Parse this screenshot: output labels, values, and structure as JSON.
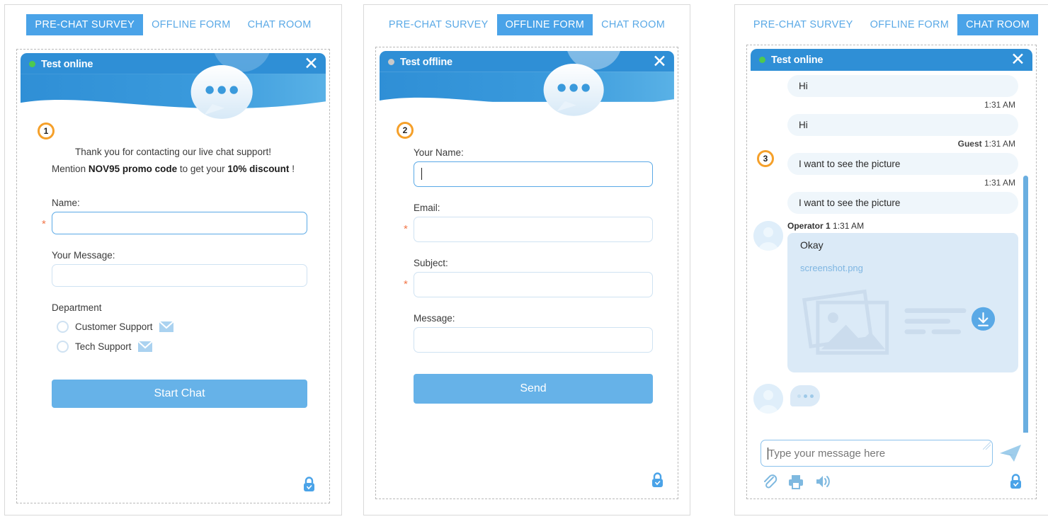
{
  "accent": "#4aa3e8",
  "header_blue": "#2f8fd6",
  "badge_orange": "#f5a02a",
  "online_green": "#4ec94e",
  "offline_grey": "#c9c9c9",
  "tabs": [
    {
      "label": "PRE-CHAT SURVEY"
    },
    {
      "label": "OFFLINE FORM"
    },
    {
      "label": "CHAT ROOM"
    }
  ],
  "panel1": {
    "step": "1",
    "active_tab": "PRE-CHAT SURVEY",
    "widget_title": "Test online",
    "status": "online",
    "close_label": "✕",
    "greeting_line1": "Thank you for contacting our live chat support!",
    "greeting_line2_pre": "Mention ",
    "greeting_line2_b1": "NOV95 promo code",
    "greeting_line2_mid": " to get your ",
    "greeting_line2_b2": "10% discount",
    "greeting_line2_post": " !",
    "name_label": "Name:",
    "name_value": "",
    "name_required": "*",
    "message_label": "Your Message:",
    "message_value": "",
    "department_label": "Department",
    "departments": [
      {
        "label": "Customer Support"
      },
      {
        "label": "Tech Support"
      }
    ],
    "submit_label": "Start Chat"
  },
  "panel2": {
    "step": "2",
    "active_tab": "OFFLINE FORM",
    "widget_title": "Test offline",
    "status": "offline",
    "close_label": "✕",
    "fields": [
      {
        "label": "Your Name:",
        "value": "",
        "required": "",
        "focused": true
      },
      {
        "label": "Email:",
        "value": "",
        "required": "*",
        "focused": false
      },
      {
        "label": "Subject:",
        "value": "",
        "required": "*",
        "focused": false
      },
      {
        "label": "Message:",
        "value": "",
        "required": "",
        "focused": false
      }
    ],
    "submit_label": "Send"
  },
  "panel3": {
    "step": "3",
    "active_tab": "CHAT ROOM",
    "widget_title": "Test online",
    "status": "online",
    "close_label": "✕",
    "messages": [
      {
        "text": "Hi",
        "time": "1:31 AM",
        "author": ""
      },
      {
        "text": "Hi",
        "time": "1:31 AM",
        "author": "Guest"
      },
      {
        "text": "I want to see the picture",
        "time": "1:31 AM",
        "author": ""
      },
      {
        "text": "I want to see the picture",
        "time": "",
        "author": ""
      }
    ],
    "operator": {
      "name": "Operator 1",
      "time": "1:31 AM",
      "text": "Okay",
      "file_name": "screenshot.png"
    },
    "input_placeholder": "Type your message here",
    "input_value": "",
    "tools": [
      {
        "name": "attach"
      },
      {
        "name": "print"
      },
      {
        "name": "sound"
      }
    ]
  }
}
